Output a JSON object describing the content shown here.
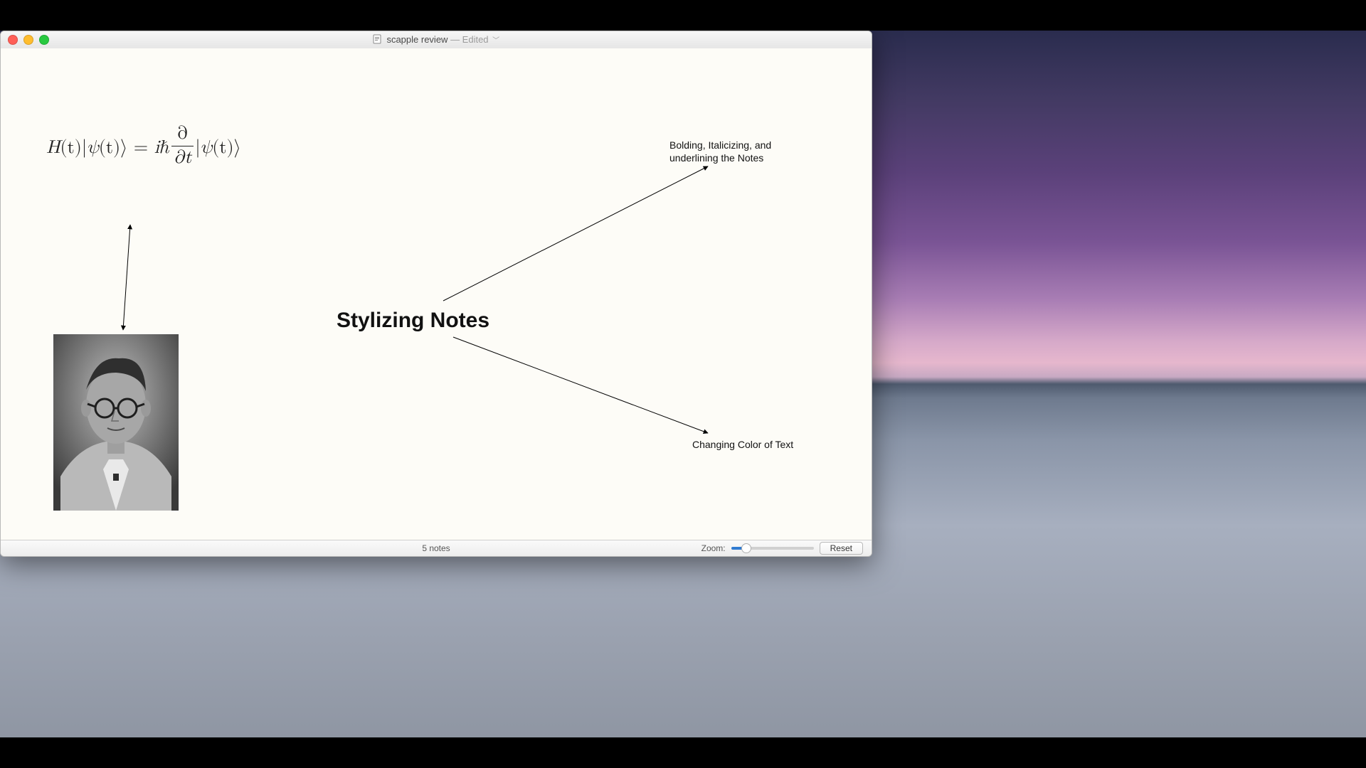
{
  "window": {
    "document_name": "scapple review",
    "edited_suffix": " — Edited"
  },
  "notes": {
    "center": "Stylizing Notes",
    "top_right": "Bolding, Italicizing, and underlining the Notes",
    "bottom_right": "Changing Color of Text"
  },
  "equation": {
    "lhs_H": "H",
    "t_group": "(t)",
    "ket_open": "|",
    "psi": "ψ",
    "ket_close": "⟩",
    "equals": " = ",
    "i": "i",
    "hbar": "ℏ",
    "partial": "∂",
    "partial_t": "∂t"
  },
  "status": {
    "count_text": "5 notes",
    "zoom_label": "Zoom:",
    "reset_label": "Reset",
    "zoom_percent": 18
  },
  "connections": [
    {
      "from": "center",
      "to": "top_right",
      "arrow_at": "to"
    },
    {
      "from": "center",
      "to": "bottom_right",
      "arrow_at": "to"
    },
    {
      "from": "photo",
      "to": "equation",
      "arrow_at": "both"
    }
  ],
  "icons": {
    "title_doc": "doc-icon",
    "title_chevron": "chevron-down-icon"
  }
}
